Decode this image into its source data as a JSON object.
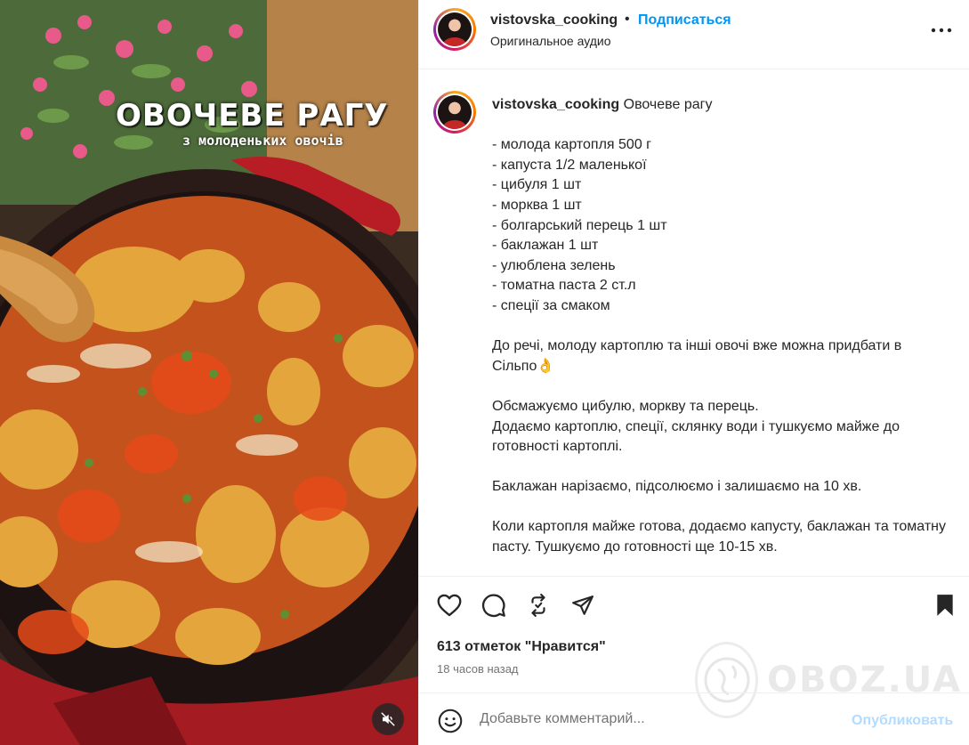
{
  "media": {
    "title": "ОВОЧЕВЕ РАГУ",
    "subtitle": "з молоденьких овочів",
    "mute_icon": "speaker-muted-icon"
  },
  "header": {
    "username": "vistovska_cooking",
    "separator": "•",
    "follow_label": "Подписаться",
    "audio_label": "Оригинальное аудио",
    "more_icon": "more-horizontal-icon"
  },
  "caption": {
    "username": "vistovska_cooking",
    "text": " Овочеве рагу\n\n- молода картопля 500 г\n- капуста 1/2 маленької\n- цибуля 1 шт\n- морква 1 шт\n- болгарський перець 1 шт\n- баклажан 1 шт\n- улюблена зелень\n- томатна паста 2 ст.л\n- спеції за смаком\n\nДо речі, молоду картоплю та інші овочі вже можна придбати в Сільпо👌\n\nОбсмажуємо цибулю, моркву та перець.\nДодаємо картоплю, спеції, склянку води і тушкуємо майже до готовності картоплі.\n\nБаклажан нарізаємо, підсолюємо і залишаємо на 10 хв.\n\nКоли картопля майже готова, додаємо капусту, баклажан та томатну пасту. Тушкуємо до готовності ще 10-15 хв."
  },
  "actions": {
    "like_icon": "heart-icon",
    "comment_icon": "comment-icon",
    "repost_icon": "repost-icon",
    "share_icon": "send-icon",
    "save_icon": "bookmark-icon"
  },
  "likes_text": "613 отметок \"Нравится\"",
  "time_text": "18 часов назад",
  "comment": {
    "placeholder": "Добавьте комментарий...",
    "publish_label": "Опубликовать",
    "emoji_icon": "smiley-icon"
  },
  "watermark": {
    "text": "OBOZ.UA"
  },
  "colors": {
    "link_blue": "#0095f6",
    "publish_disabled": "#b3dbff",
    "text_primary": "#262626",
    "text_secondary": "#737373"
  }
}
